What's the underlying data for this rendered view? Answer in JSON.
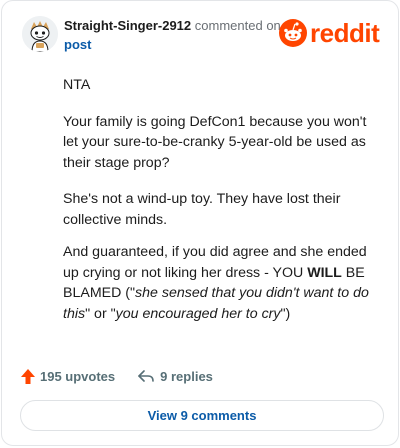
{
  "header": {
    "username": "Straight-Singer-2912",
    "action": "commented on",
    "link": "post",
    "brand": "reddit"
  },
  "comment": {
    "p1": "NTA",
    "p2": "Your family is going DefCon1 because you won't let your sure-to-be-cranky 5-year-old be used as their stage prop?",
    "p3": "She's not a wind-up toy. They have lost their collective minds.",
    "p4_a": "And guaranteed, if you did agree and she ended up crying or not liking her dress - YOU ",
    "p4_b": "WILL",
    "p4_c": " BE BLAMED (\"",
    "p4_d": "she sensed that you didn't want to do this",
    "p4_e": "\" or \"",
    "p4_f": "you encouraged her to cry",
    "p4_g": "\")"
  },
  "footer": {
    "upvotes": "195 upvotes",
    "replies": "9 replies",
    "view_comments": "View 9 comments"
  },
  "colors": {
    "brand": "#ff4500",
    "link": "#0b5ba8",
    "muted": "#576f76"
  },
  "icons": {
    "avatar": "snoo-avatar",
    "logo": "reddit-snoo-icon",
    "upvote": "upvote-arrow-icon",
    "reply": "reply-arrow-icon"
  }
}
